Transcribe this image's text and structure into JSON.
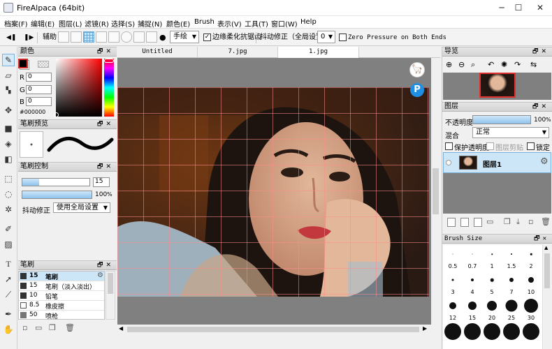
{
  "window": {
    "title": "FireAlpaca (64bit)",
    "minimize_icon": "─",
    "maximize_icon": "☐",
    "close_icon": "✕"
  },
  "menu": [
    "档案(F)",
    "编辑(E)",
    "图层(L)",
    "滤镜(R)",
    "选择(S)",
    "捕捉(N)",
    "颜色(E)",
    "Brush",
    "表示(V)",
    "工具(T)",
    "窗口(W)",
    "Help"
  ],
  "toolbar": {
    "snap_label": "辅助",
    "brush_mode": "手绘",
    "antialias_label": "边缘柔化抗锯齿",
    "antialias_checked": true,
    "stabilizer_label": "抖动修正（全局设置）",
    "stabilizer_value": "0",
    "zero_pressure_label": "Zero Pressure on Both Ends",
    "zero_pressure_checked": false
  },
  "color_panel": {
    "title": "颜色",
    "r_label": "R",
    "r_value": "0",
    "g_label": "G",
    "g_value": "0",
    "b_label": "B",
    "b_value": "0",
    "hex": "#000000",
    "primary_color": "#000000",
    "hue_color": "#ff0000"
  },
  "brush_preview": {
    "title": "笔刷预览"
  },
  "brush_control": {
    "title": "笔刷控制",
    "size_value": "15",
    "opacity_value": "100",
    "opacity_unit": "%",
    "size_level": 0.25,
    "opacity_level": 1.0,
    "stabilizer_label": "抖动修正",
    "stabilizer_option": "使用全局设置"
  },
  "brush_panel": {
    "title": "笔刷",
    "items": [
      {
        "size": "15",
        "name": "笔刷",
        "selected": true
      },
      {
        "size": "15",
        "name": "笔刷（淡入淡出）",
        "selected": false
      },
      {
        "size": "10",
        "name": "铅笔",
        "selected": false
      },
      {
        "size": "8.5",
        "name": "橡皮擦",
        "selected": false
      },
      {
        "size": "50",
        "name": "喷枪",
        "selected": false
      }
    ]
  },
  "tabs": [
    "Untitled",
    "7.jpg",
    "1.jpg"
  ],
  "active_tab": 2,
  "navigator": {
    "title": "导览"
  },
  "layers": {
    "title": "图层",
    "opacity_label": "不透明度",
    "opacity_value": "100",
    "opacity_unit": "%",
    "blend_label": "混合",
    "blend_value": "正常",
    "protect_alpha": "保护透明度",
    "clipping": "图层剪贴",
    "lock": "锁定",
    "layer_name": "图层1"
  },
  "brush_size": {
    "title": "Brush Size",
    "labels": [
      "0.5",
      "0.7",
      "1",
      "1.5",
      "2",
      "3",
      "4",
      "5",
      "7",
      "10",
      "12",
      "15",
      "20",
      "25",
      "30"
    ]
  },
  "photo_palette": {
    "bg_dark": "#2a1a14",
    "wood": "#6b3512",
    "skin": "#e2b79a",
    "skin_shadow": "#c28a6e",
    "hair": "#1e140f",
    "lips": "#c2383c",
    "sleeve": "#9fb0bd"
  }
}
